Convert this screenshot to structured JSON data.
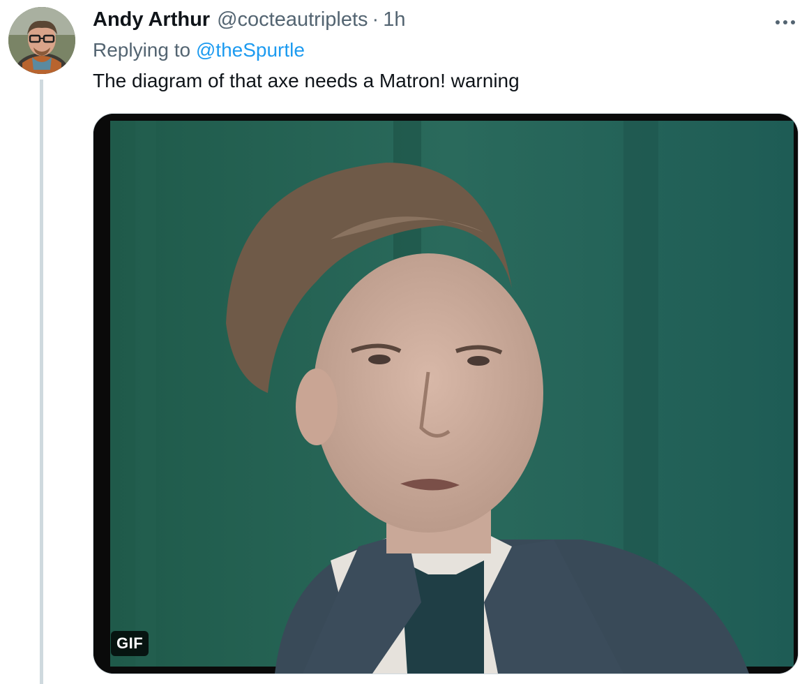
{
  "tweet": {
    "author_name": "Andy Arthur",
    "author_handle": "@cocteautriplets",
    "separator": "·",
    "time": "1h",
    "replying_prefix": "Replying to",
    "replying_to": "@theSpurtle",
    "text": "The diagram of that axe needs a Matron! warning",
    "more_icon": "more-horizontal-icon"
  },
  "media": {
    "type": "gif",
    "badge": "GIF"
  },
  "colors": {
    "link": "#1d9bf0",
    "secondary_text": "#536471",
    "primary_text": "#0f1419",
    "thread_line": "#cfd9de"
  }
}
